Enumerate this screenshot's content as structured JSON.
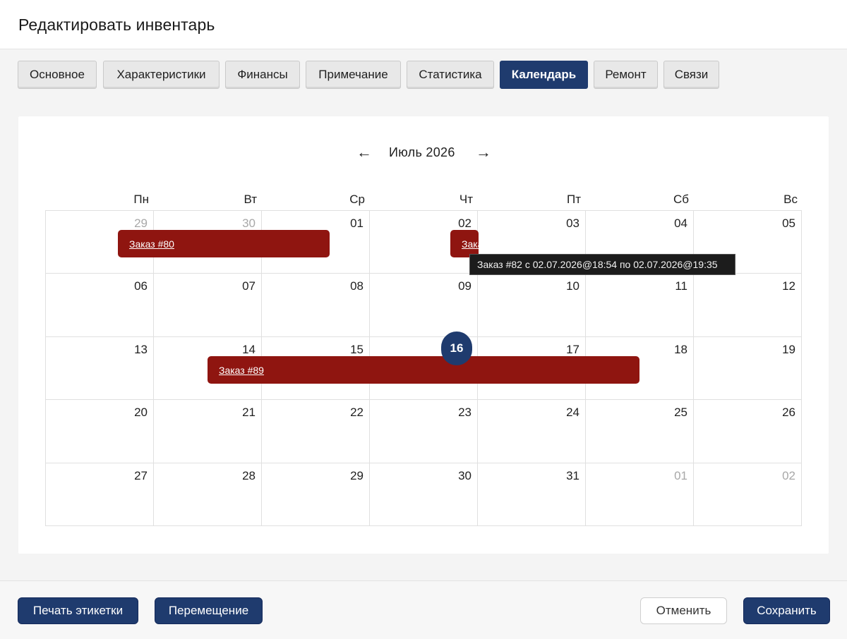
{
  "dialog": {
    "title": "Редактировать инвентарь"
  },
  "tabs": [
    {
      "label": "Основное"
    },
    {
      "label": "Характеристики"
    },
    {
      "label": "Финансы"
    },
    {
      "label": "Примечание"
    },
    {
      "label": "Статистика"
    },
    {
      "label": "Календарь",
      "active": true
    },
    {
      "label": "Ремонт"
    },
    {
      "label": "Связи"
    }
  ],
  "calendar": {
    "month_label": "Июль 2026",
    "prev_arrow": "←",
    "next_arrow": "→",
    "weekdays": [
      "Пн",
      "Вт",
      "Ср",
      "Чт",
      "Пт",
      "Сб",
      "Вс"
    ],
    "weeks": [
      [
        "29",
        "30",
        "01",
        "02",
        "03",
        "04",
        "05"
      ],
      [
        "06",
        "07",
        "08",
        "09",
        "10",
        "11",
        "12"
      ],
      [
        "13",
        "14",
        "15",
        "16",
        "17",
        "18",
        "19"
      ],
      [
        "20",
        "21",
        "22",
        "23",
        "24",
        "25",
        "26"
      ],
      [
        "27",
        "28",
        "29",
        "30",
        "31",
        "01",
        "02"
      ]
    ],
    "today": "16",
    "events": [
      {
        "label": "Заказ #80",
        "color": "#8f1510"
      },
      {
        "label": "Заказ #82",
        "color": "#8f1510"
      },
      {
        "label": "Заказ #89",
        "color": "#8f1510"
      }
    ],
    "tooltip": "Заказ #82 с 02.07.2026@18:54 по 02.07.2026@19:35"
  },
  "footer": {
    "print_label": "Печать этикетки",
    "move_label": "Перемещение",
    "cancel_label": "Отменить",
    "save_label": "Сохранить"
  },
  "colors": {
    "accent": "#1f3b6e",
    "event": "#8f1510"
  }
}
